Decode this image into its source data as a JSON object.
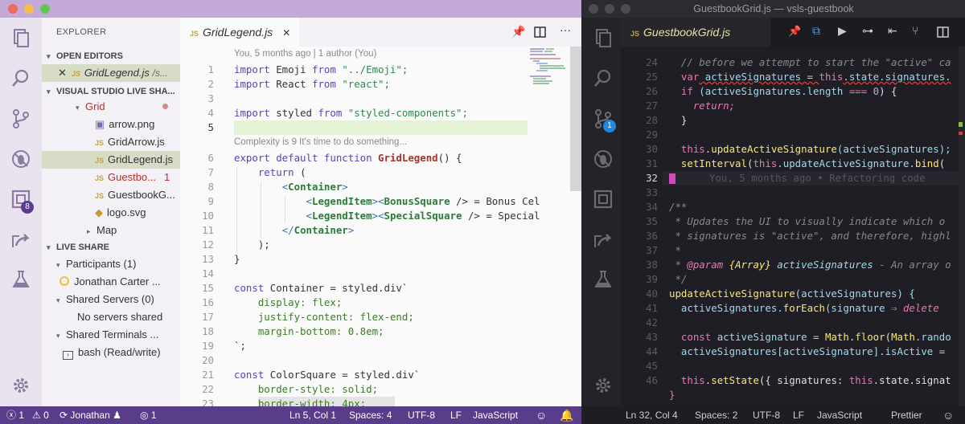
{
  "left": {
    "sidebar": {
      "title": "EXPLORER",
      "open_editors_header": "OPEN EDITORS",
      "open_editor_file": "GridLegend.js",
      "open_editor_path": "/s...",
      "session_header": "VISUAL STUDIO LIVE SHA...",
      "folder": "Grid",
      "files": [
        "arrow.png",
        "GridArrow.js",
        "GridLegend.js",
        "Guestbo...",
        "GuestbookG...",
        "logo.svg",
        "Map"
      ],
      "guestbook_count": "1",
      "live_share_header": "LIVE SHARE",
      "participants": "Participants (1)",
      "participant_name": "Jonathan Carter ...",
      "shared_servers": "Shared Servers (0)",
      "no_servers": "No servers shared",
      "shared_terminals": "Shared Terminals ...",
      "terminal": "bash (Read/write)"
    },
    "activity_badge": "8",
    "tab": {
      "label": "GridLegend.js",
      "icon": "JS"
    },
    "blame_header": "You, 5 months ago | 1 author (You)",
    "complexity": "Complexity is 9 It's time to do something...",
    "line_numbers": [
      "1",
      "2",
      "3",
      "4",
      "5",
      "6",
      "7",
      "8",
      "9",
      "10",
      "11",
      "12",
      "13",
      "14",
      "15",
      "16",
      "17",
      "18",
      "19",
      "20",
      "21",
      "22",
      "23"
    ],
    "code": {
      "l1": [
        "import",
        " Emoji ",
        "from",
        " \"../Emoji\";"
      ],
      "l2": [
        "import",
        " React ",
        "from",
        " \"react\";"
      ],
      "l4": [
        "import",
        " styled ",
        "from",
        " \"styled-components\";"
      ],
      "l6": [
        "export default function",
        " ",
        "GridLegend",
        "() {"
      ],
      "l7": [
        "return",
        " ("
      ],
      "l8": [
        "<",
        "Container",
        ">"
      ],
      "l9": [
        "<",
        "LegendItem",
        "><",
        "BonusSquare",
        " /> = Bonus Cel"
      ],
      "l10": [
        "<",
        "LegendItem",
        "><",
        "SpecialSquare",
        " /> = Special"
      ],
      "l11": [
        "</",
        "Container",
        ">"
      ],
      "l12": ");",
      "l13": "}",
      "l15": [
        "const",
        " Container = styled.div`"
      ],
      "l16": "display: flex;",
      "l17": "justify-content: flex-end;",
      "l18": "margin-bottom: 0.8em;",
      "l19": "`;",
      "l21": [
        "const",
        " ColorSquare = styled.div`"
      ],
      "l22": "border-style: solid;",
      "l23": "border-width: 4px;"
    },
    "status": {
      "errors": "1",
      "warnings": "0",
      "user": "Jonathan",
      "share_count": "1",
      "position": "Ln 5, Col 1",
      "spaces": "Spaces: 4",
      "encoding": "UTF-8",
      "eol": "LF",
      "language": "JavaScript"
    }
  },
  "right": {
    "window_title": "GuestbookGrid.js — vsls-guestbook",
    "tab": {
      "label": "GuestbookGrid.js",
      "icon": "JS"
    },
    "source_control_badge": "1",
    "line_numbers": [
      "24",
      "25",
      "26",
      "27",
      "28",
      "29",
      "30",
      "31",
      "32",
      "33",
      "34",
      "35",
      "36",
      "37",
      "38",
      "39",
      "40",
      "41",
      "42",
      "43",
      "44",
      "45",
      "46"
    ],
    "code": {
      "l24": "// before we attempt to start the \"active\" ca",
      "l25": [
        "var",
        " activeSignatures = ",
        "this",
        ".state.signatures."
      ],
      "l26": [
        "if",
        " (activeSignatures.length ",
        "===",
        " ",
        "0",
        ") {"
      ],
      "l27": "return;",
      "l28": "}",
      "l30": [
        "this",
        ".",
        "updateActiveSignature",
        "(activeSignatures);"
      ],
      "l31": [
        "setInterval",
        "(",
        "this",
        ".updateActiveSignature.",
        "bind",
        "("
      ],
      "l32": "You, 5 months ago • Refactoring code",
      "l34": "/**",
      "l35": "* Updates the UI to visually indicate which o",
      "l36": "* signatures is \"active\", and therefore, highl",
      "l37": "*",
      "l38": [
        "* ",
        "@param",
        " {Array} ",
        "activeSignatures",
        " - An array o"
      ],
      "l39": "*/",
      "l40": [
        "updateActiveSignature",
        "(activeSignatures) {"
      ],
      "l41": [
        "activeSignatures.",
        "forEach",
        "(signature ",
        "⇒",
        " ",
        "delete"
      ],
      "l43": [
        "const",
        " activeSignature = ",
        "Math",
        ".",
        "floor",
        "(",
        "Math",
        ".rando"
      ],
      "l44": [
        "activeSignatures[activeSignature].isActive ="
      ],
      "l46": [
        "this",
        ".",
        "setState",
        "({ signatures: ",
        "this",
        ".state.signat"
      ],
      "l47": "}"
    },
    "status": {
      "position": "Ln 32, Col 4",
      "spaces": "Spaces: 2",
      "encoding": "UTF-8",
      "eol": "LF",
      "language": "JavaScript",
      "formatter": "Prettier"
    }
  },
  "colors": {
    "left_titlebar": "#c3a9d6",
    "left_status": "#5a3d8a",
    "right_bg": "#1e1e24"
  }
}
